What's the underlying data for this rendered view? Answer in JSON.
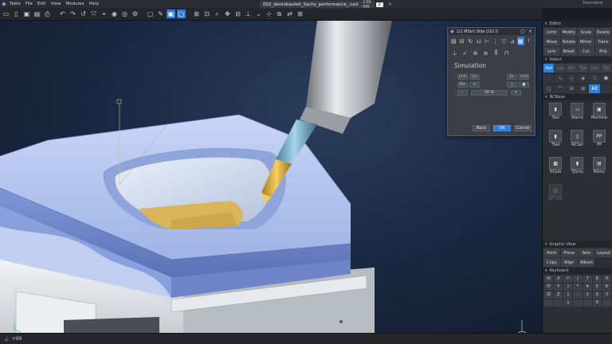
{
  "menu": {
    "items": [
      "Tebis",
      "File",
      "Edit",
      "View",
      "Modules",
      "Help"
    ]
  },
  "filetab": {
    "name": "002_demobauteil_Sachs_performance_.cad",
    "memory": "139 MB",
    "count": "2",
    "close": "×"
  },
  "profile": "Standard",
  "viewport_icons": {
    "axis_top": "Z",
    "axis_bottom": "Y"
  },
  "status": {
    "zoom": "+99"
  },
  "sim_dialog": {
    "title": "1/1 MSim Side D10.0",
    "section": "Simulation",
    "row1": [
      "|<<",
      "|<",
      "|>",
      ">>|"
    ],
    "row2": [
      "O>",
      "<",
      "",
      "●"
    ],
    "speed_minus": "-",
    "speed_value": "50 %",
    "speed_plus": "+",
    "back": "Back",
    "ok": "OK",
    "cancel": "Cancel"
  },
  "panel": {
    "editor_title": "Editor",
    "editor_buttons": [
      "Limit",
      "Modify",
      "Scale",
      "Delete",
      "Move",
      "Rotate",
      "Mirror",
      "Trans",
      "Link",
      "Break",
      "Cut",
      "Proj"
    ],
    "select_title": "Select",
    "select_row": [
      "Def",
      "Lay",
      "Ext",
      "Typ",
      "Col",
      "Tip"
    ],
    "select_all": "All",
    "ncbase_title": "NCBase",
    "ncbase_items": [
      {
        "label": "Tool",
        "icon": "▮"
      },
      {
        "label": "Macro",
        "icon": "▭"
      },
      {
        "label": "Machine",
        "icon": "▣"
      },
      {
        "label": "TSet",
        "icon": "▮"
      },
      {
        "label": "NCSet",
        "icon": "▯"
      },
      {
        "label": "PP",
        "icon": "PP"
      },
      {
        "label": "NCJob",
        "icon": "▩"
      },
      {
        "label": "TJSmu",
        "icon": "▮"
      },
      {
        "label": "RSmu",
        "icon": "▤"
      },
      {
        "label": "NC Info",
        "icon": "▨"
      }
    ],
    "graphic_title": "Graphic View",
    "graphic_buttons": [
      "Point",
      "Plane",
      "Axis",
      "Layout",
      "Copy",
      "Align",
      "Album"
    ],
    "keyboard_title": "Keyboard",
    "keyboard_keys": [
      "IX",
      "X",
      "↶",
      "/",
      "7",
      "8",
      "9",
      "IY",
      "Y",
      "⇧",
      "*",
      "4",
      "5",
      "6",
      "IZ",
      "Z",
      "⇩",
      "-",
      "1",
      "2",
      "3",
      "",
      "",
      "↲",
      "",
      "",
      "0",
      "."
    ]
  },
  "colors": {
    "accent": "#2f7fd8",
    "part": "#b9c9ee",
    "tool_gold": "#e1b23a",
    "pocket_gold": "#d8b659"
  }
}
